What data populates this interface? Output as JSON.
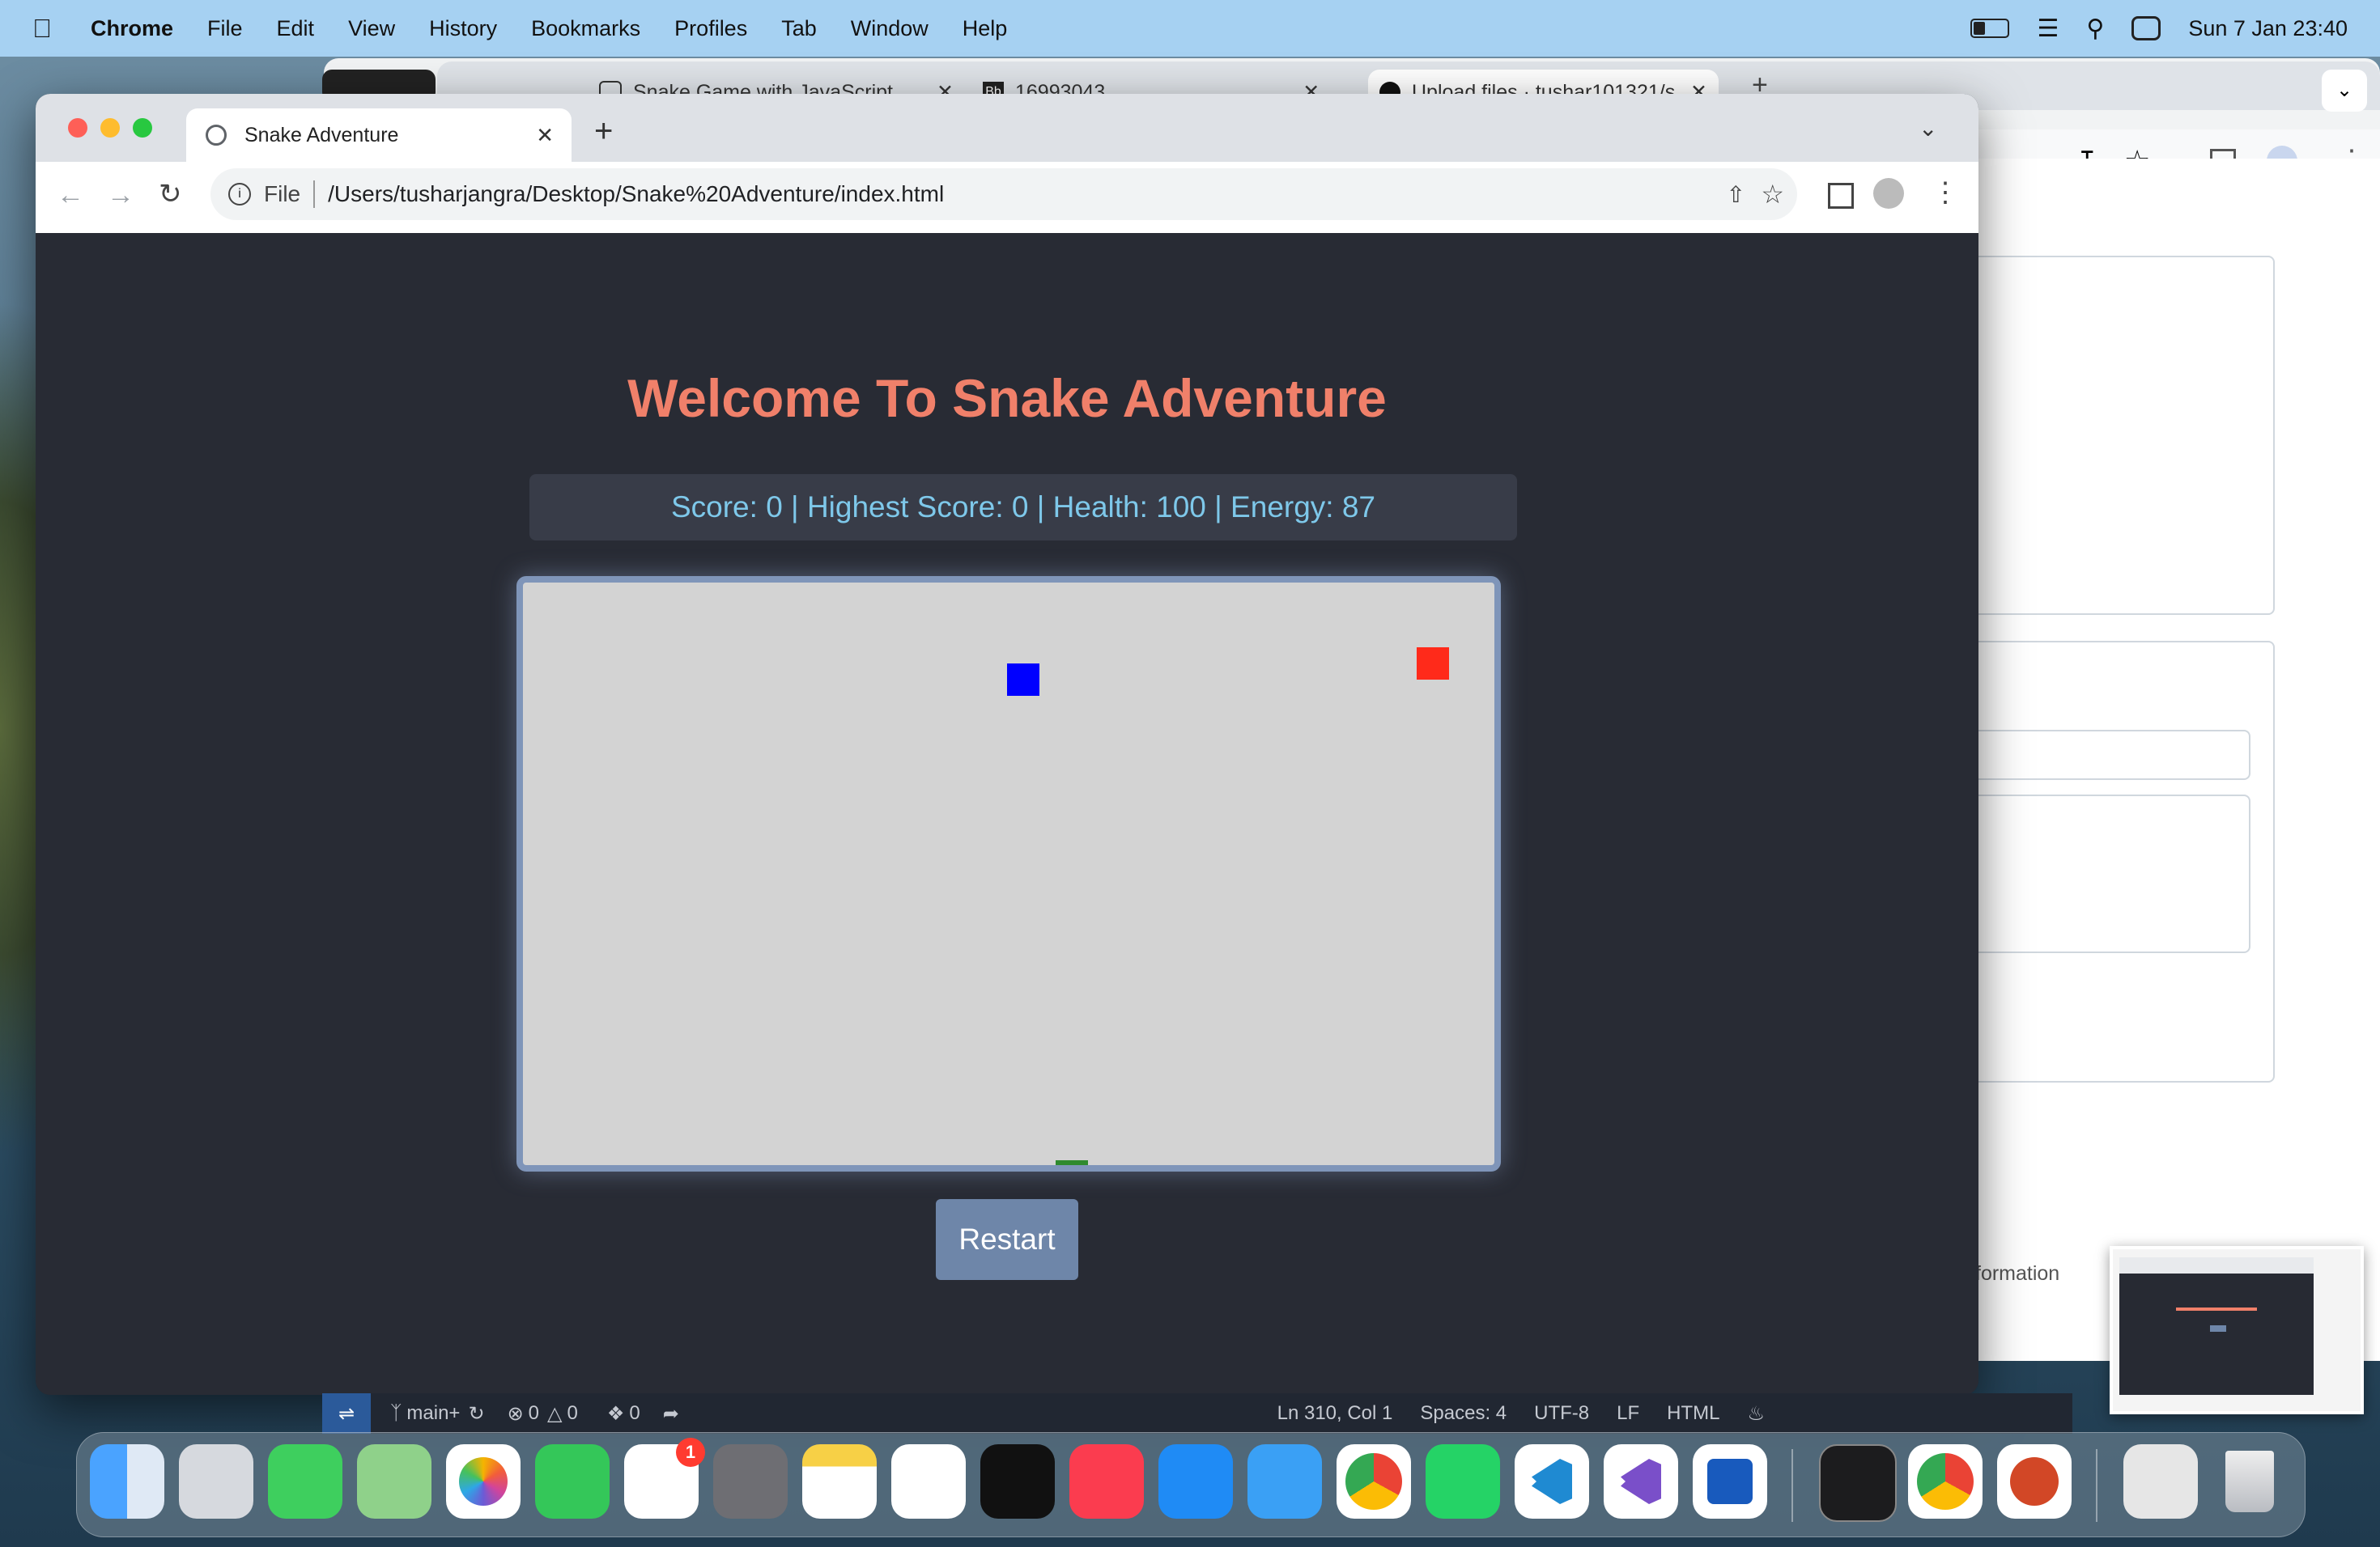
{
  "menubar": {
    "app": "Chrome",
    "items": [
      "File",
      "Edit",
      "View",
      "History",
      "Bookmarks",
      "Profiles",
      "Tab",
      "Window",
      "Help"
    ],
    "datetime": "Sun 7 Jan  23:40"
  },
  "bg_window": {
    "tabs": [
      "Snake Game with JavaScript",
      "16993043",
      "Upload files · tushar101321/s..."
    ],
    "partial_text": "formation"
  },
  "browser": {
    "tab_title": "Snake Adventure",
    "address_prefix": "File",
    "url": "/Users/tusharjangra/Desktop/Snake%20Adventure/index.html"
  },
  "game": {
    "title": "Welcome To Snake Adventure",
    "score_label": "Score: 0 | Highest Score: 0 | Health: 100 | Energy: 87",
    "restart_label": "Restart",
    "colors": {
      "food": "#0000ff",
      "enemy": "#ff2a1a",
      "snake": "#2f8a2f",
      "board": "#d3d3d3",
      "title": "#f0806a"
    }
  },
  "vscode_status": {
    "branch": "main+",
    "errors": "0",
    "warnings": "0",
    "ports": "0",
    "position": "Ln 310, Col 1",
    "spaces": "Spaces: 4",
    "encoding": "UTF-8",
    "eol": "LF",
    "language": "HTML"
  },
  "dock": {
    "reminders_badge": "1",
    "icons": [
      "finder-icon",
      "launchpad-icon",
      "messages-icon",
      "maps-icon",
      "photos-icon",
      "facetime-icon",
      "reminders-icon",
      "system-settings-icon",
      "notes-icon",
      "freeform-icon",
      "appletv-icon",
      "music-icon",
      "appstore-icon",
      "safari-icon",
      "chrome-icon",
      "whatsapp-icon",
      "vscode-icon",
      "visualstudio-icon",
      "word-icon",
      "terminal-icon",
      "chrome-icon",
      "powerpoint-icon",
      "preview-folder-icon",
      "trash-icon"
    ]
  }
}
